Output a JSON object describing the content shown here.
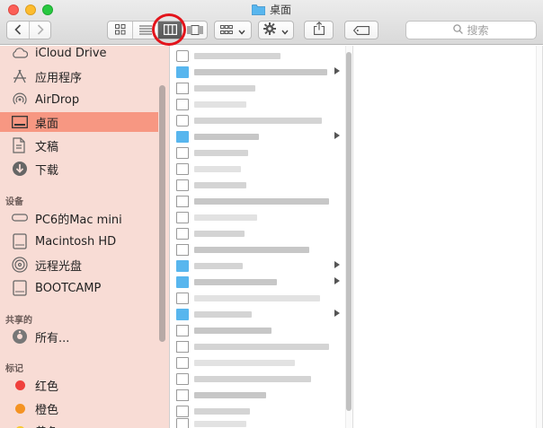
{
  "window": {
    "title": "桌面"
  },
  "toolbar": {
    "search_placeholder": "搜索",
    "view_modes": [
      "icon-view",
      "list-view",
      "column-view",
      "cover-flow-view"
    ],
    "active_view": "column-view"
  },
  "sidebar": {
    "favorites": [
      {
        "label": "iCloud Drive",
        "icon": "cloud-icon"
      },
      {
        "label": "应用程序",
        "icon": "applications-icon"
      },
      {
        "label": "AirDrop",
        "icon": "airdrop-icon"
      },
      {
        "label": "桌面",
        "icon": "desktop-icon",
        "selected": true
      },
      {
        "label": "文稿",
        "icon": "documents-icon"
      },
      {
        "label": "下载",
        "icon": "downloads-icon"
      }
    ],
    "devices_header": "设备",
    "devices": [
      {
        "label": "PC6的Mac mini",
        "icon": "computer-icon"
      },
      {
        "label": "Macintosh HD",
        "icon": "hard-drive-icon"
      },
      {
        "label": "远程光盘",
        "icon": "optical-disc-icon"
      },
      {
        "label": "BOOTCAMP",
        "icon": "hard-drive-icon"
      }
    ],
    "shared_header": "共享的",
    "shared": [
      {
        "label": "所有...",
        "icon": "network-icon"
      }
    ],
    "tags_header": "标记",
    "tags": [
      {
        "label": "红色",
        "color": "#f0403c"
      },
      {
        "label": "橙色",
        "color": "#f49323"
      },
      {
        "label": "黄色",
        "color": "#f7c72e"
      }
    ]
  },
  "colors": {
    "sidebar_bg": "#f8dcd5",
    "sidebar_selected": "#f79782",
    "folder_blue": "#58b6ee",
    "highlight_ring": "#e3141b"
  }
}
